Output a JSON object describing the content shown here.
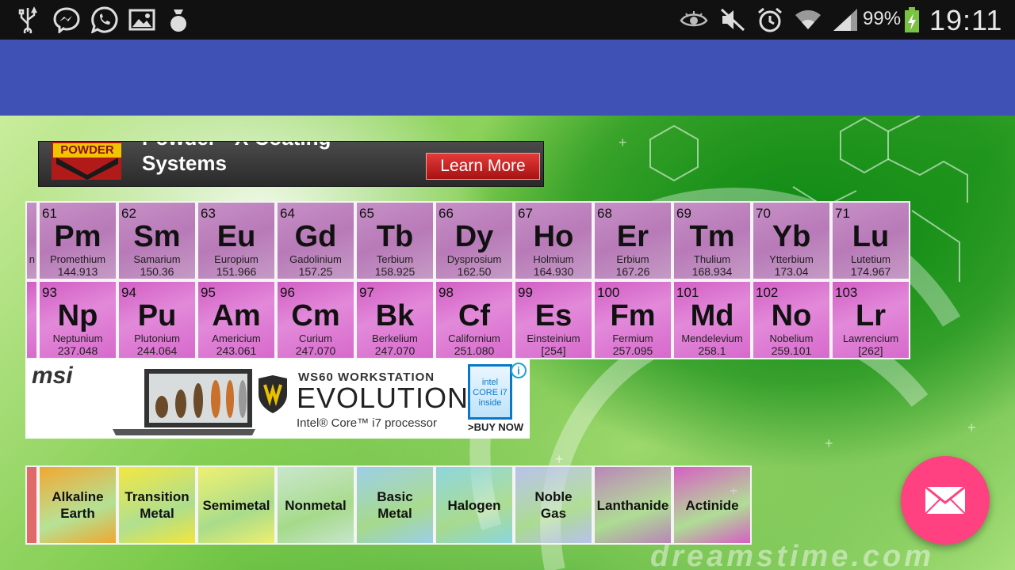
{
  "status_bar": {
    "battery_percent": "99%",
    "time": "19:11",
    "icons": [
      "usb-icon",
      "messenger-icon",
      "whatsapp-icon",
      "gallery-icon",
      "app-icon",
      "eye-icon",
      "mute-icon",
      "alarm-icon",
      "wifi-icon",
      "signal-icon",
      "battery-icon"
    ]
  },
  "ad_top": {
    "brand": "POWDER",
    "headline_line1": "Powder - X Coating",
    "headline_line2": "Systems",
    "button_label": "Learn More"
  },
  "lanthanides": [
    {
      "number": "61",
      "symbol": "Pm",
      "name": "Promethium",
      "mass": "144.913"
    },
    {
      "number": "62",
      "symbol": "Sm",
      "name": "Samarium",
      "mass": "150.36"
    },
    {
      "number": "63",
      "symbol": "Eu",
      "name": "Europium",
      "mass": "151.966"
    },
    {
      "number": "64",
      "symbol": "Gd",
      "name": "Gadolinium",
      "mass": "157.25"
    },
    {
      "number": "65",
      "symbol": "Tb",
      "name": "Terbium",
      "mass": "158.925"
    },
    {
      "number": "66",
      "symbol": "Dy",
      "name": "Dysprosium",
      "mass": "162.50"
    },
    {
      "number": "67",
      "symbol": "Ho",
      "name": "Holmium",
      "mass": "164.930"
    },
    {
      "number": "68",
      "symbol": "Er",
      "name": "Erbium",
      "mass": "167.26"
    },
    {
      "number": "69",
      "symbol": "Tm",
      "name": "Thulium",
      "mass": "168.934"
    },
    {
      "number": "70",
      "symbol": "Yb",
      "name": "Ytterbium",
      "mass": "173.04"
    },
    {
      "number": "71",
      "symbol": "Lu",
      "name": "Lutetium",
      "mass": "174.967"
    }
  ],
  "actinides": [
    {
      "number": "93",
      "symbol": "Np",
      "name": "Neptunium",
      "mass": "237.048"
    },
    {
      "number": "94",
      "symbol": "Pu",
      "name": "Plutonium",
      "mass": "244.064"
    },
    {
      "number": "95",
      "symbol": "Am",
      "name": "Americium",
      "mass": "243.061"
    },
    {
      "number": "96",
      "symbol": "Cm",
      "name": "Curium",
      "mass": "247.070"
    },
    {
      "number": "97",
      "symbol": "Bk",
      "name": "Berkelium",
      "mass": "247.070"
    },
    {
      "number": "98",
      "symbol": "Cf",
      "name": "Californium",
      "mass": "251.080"
    },
    {
      "number": "99",
      "symbol": "Es",
      "name": "Einsteinium",
      "mass": "[254]"
    },
    {
      "number": "100",
      "symbol": "Fm",
      "name": "Fermium",
      "mass": "257.095"
    },
    {
      "number": "101",
      "symbol": "Md",
      "name": "Mendelevium",
      "mass": "258.1"
    },
    {
      "number": "102",
      "symbol": "No",
      "name": "Nobelium",
      "mass": "259.101"
    },
    {
      "number": "103",
      "symbol": "Lr",
      "name": "Lawrencium",
      "mass": "[262]"
    }
  ],
  "partial_cell_label": "n",
  "ad_msi": {
    "brand": "msi",
    "tagline": "WS60 WORKSTATION",
    "headline": "EVOLUTION",
    "processor": "Intel® Core™ i7 processor",
    "badge": "intel CORE i7 inside",
    "cta": ">BUY NOW"
  },
  "legend": [
    {
      "label_lines": [
        "Alkaline",
        "Earth"
      ],
      "color": "#f0a830"
    },
    {
      "label_lines": [
        "Transition",
        "Metal"
      ],
      "color": "#f3e640"
    },
    {
      "label_lines": [
        "Semimetal"
      ],
      "color": "#eef070"
    },
    {
      "label_lines": [
        "Nonmetal"
      ],
      "color": "#c8e6cc"
    },
    {
      "label_lines": [
        "Basic",
        "Metal"
      ],
      "color": "#9ccfe8"
    },
    {
      "label_lines": [
        "Halogen"
      ],
      "color": "#8dd6df"
    },
    {
      "label_lines": [
        "Noble",
        "Gas"
      ],
      "color": "#b9c2ec"
    },
    {
      "label_lines": [
        "Lanthanide"
      ],
      "color": "#b986b8"
    },
    {
      "label_lines": [
        "Actinide"
      ],
      "color": "#d65fc4"
    }
  ],
  "watermark": "dreamstime.com",
  "colors": {
    "action_bar": "#3f51b5",
    "fab": "#ff4081",
    "status_bar": "#111111"
  }
}
